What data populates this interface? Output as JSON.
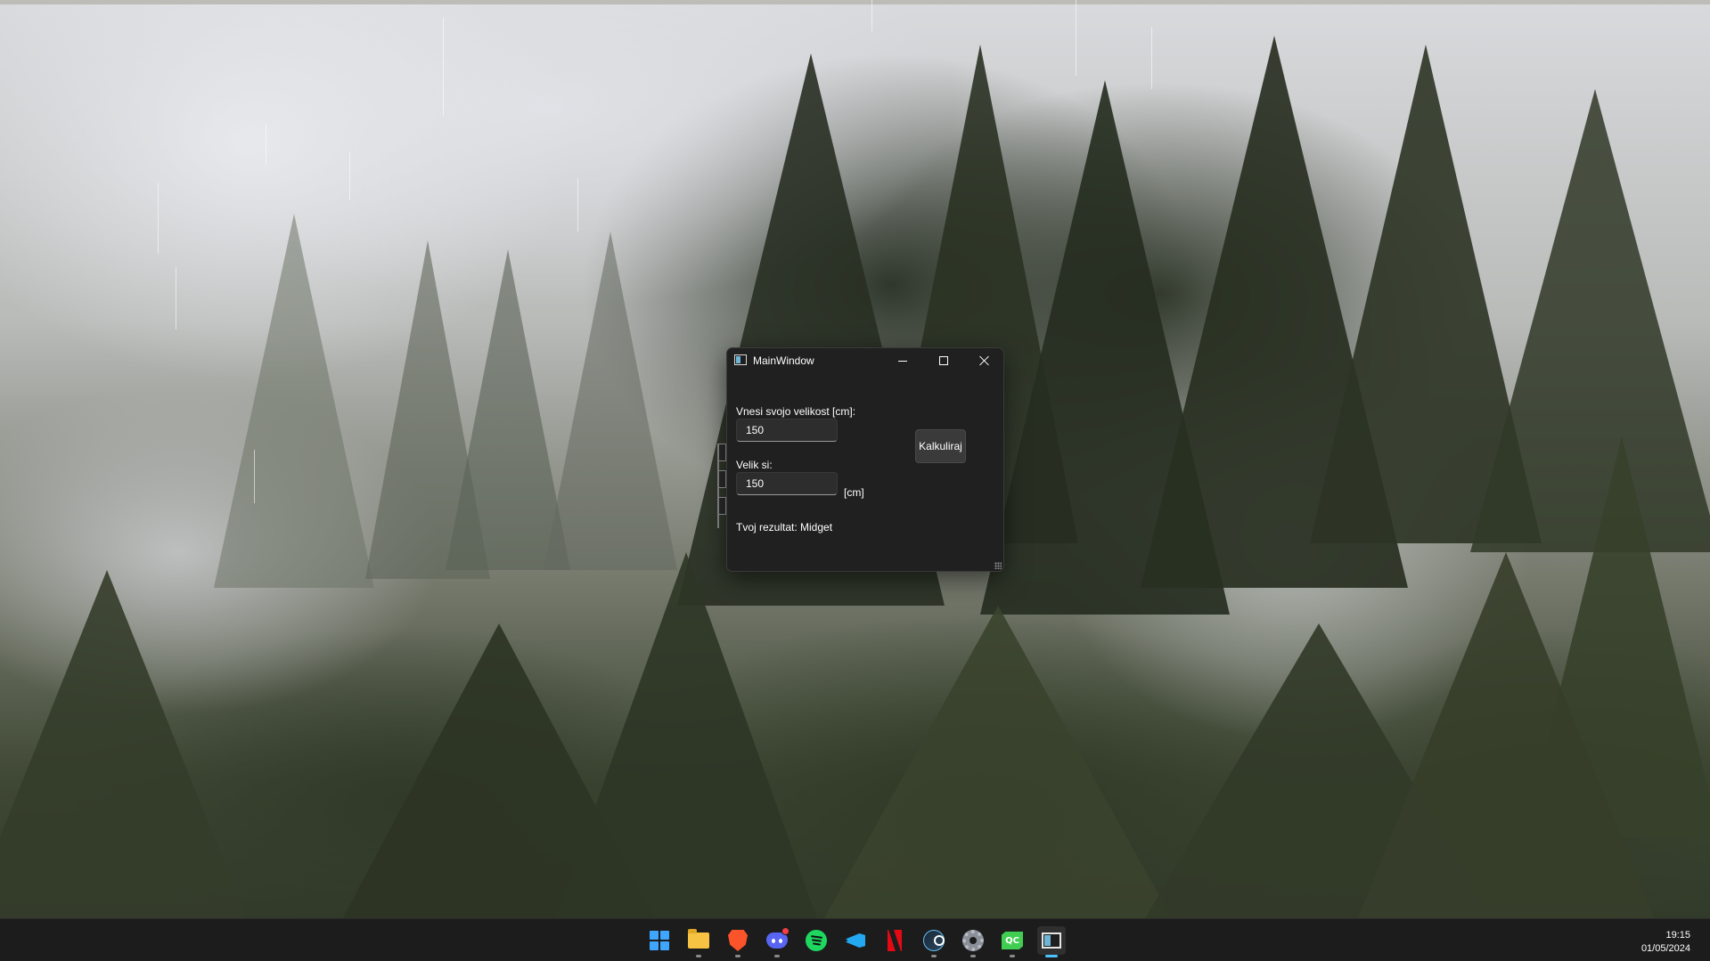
{
  "window": {
    "title": "MainWindow",
    "input_label": "Vnesi svojo velikost [cm]:",
    "input_value": "150",
    "calc_button": "Kalkuliraj",
    "output_label": "Velik si:",
    "output_value": "150",
    "output_unit": "[cm]",
    "result_text": "Tvoj rezultat: Midget"
  },
  "taskbar": {
    "icons": [
      "start-icon",
      "file-explorer-icon",
      "brave-browser-icon",
      "discord-icon",
      "spotify-icon",
      "vscode-icon",
      "netflix-icon",
      "steam-icon",
      "settings-icon",
      "qt-creator-icon",
      "mainwindow-app-icon"
    ],
    "qt_label": "QC",
    "active_app": "mainwindow-app-icon"
  },
  "clock": {
    "time": "19:15",
    "date": "01/05/2024"
  },
  "colors": {
    "window_bg": "#202020",
    "taskbar_bg": "#1c1c1c",
    "accent": "#4cc2ff"
  }
}
